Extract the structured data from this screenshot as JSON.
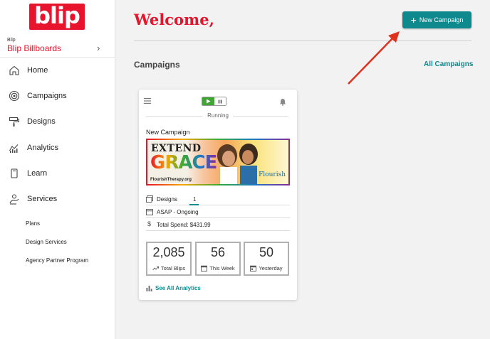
{
  "sidebar": {
    "logo_text": "blip",
    "account_label": "Blip",
    "account_name": "Blip Billboards",
    "nav": [
      {
        "label": "Home",
        "icon": "home-icon"
      },
      {
        "label": "Campaigns",
        "icon": "target-icon"
      },
      {
        "label": "Designs",
        "icon": "paint-roller-icon"
      },
      {
        "label": "Analytics",
        "icon": "analytics-icon"
      },
      {
        "label": "Learn",
        "icon": "book-icon"
      },
      {
        "label": "Services",
        "icon": "services-icon"
      }
    ],
    "sub_items": [
      "Plans",
      "Design Services",
      "Agency Partner Program"
    ]
  },
  "main": {
    "welcome": "Welcome,",
    "new_campaign_label": "New Campaign",
    "campaigns_heading": "Campaigns",
    "all_campaigns_link": "All Campaigns"
  },
  "card": {
    "status": "Running",
    "title": "New Campaign",
    "banner": {
      "line1": "EXTEND",
      "line2": "GRACE",
      "url": "FlourishTherapy.org",
      "brand": "Flourish"
    },
    "designs_label": "Designs",
    "designs_count": "1",
    "schedule": "ASAP - Ongoing",
    "total_spend": "Total Spend: $431.99",
    "stats": [
      {
        "value": "2,085",
        "label": "Total Blips"
      },
      {
        "value": "56",
        "label": "This Week"
      },
      {
        "value": "50",
        "label": "Yesterday"
      }
    ],
    "see_analytics": "See All Analytics"
  },
  "colors": {
    "brand_red": "#e8132c",
    "teal": "#0e8a8f",
    "play_green": "#41a535",
    "annotation_arrow": "#e0301e"
  }
}
